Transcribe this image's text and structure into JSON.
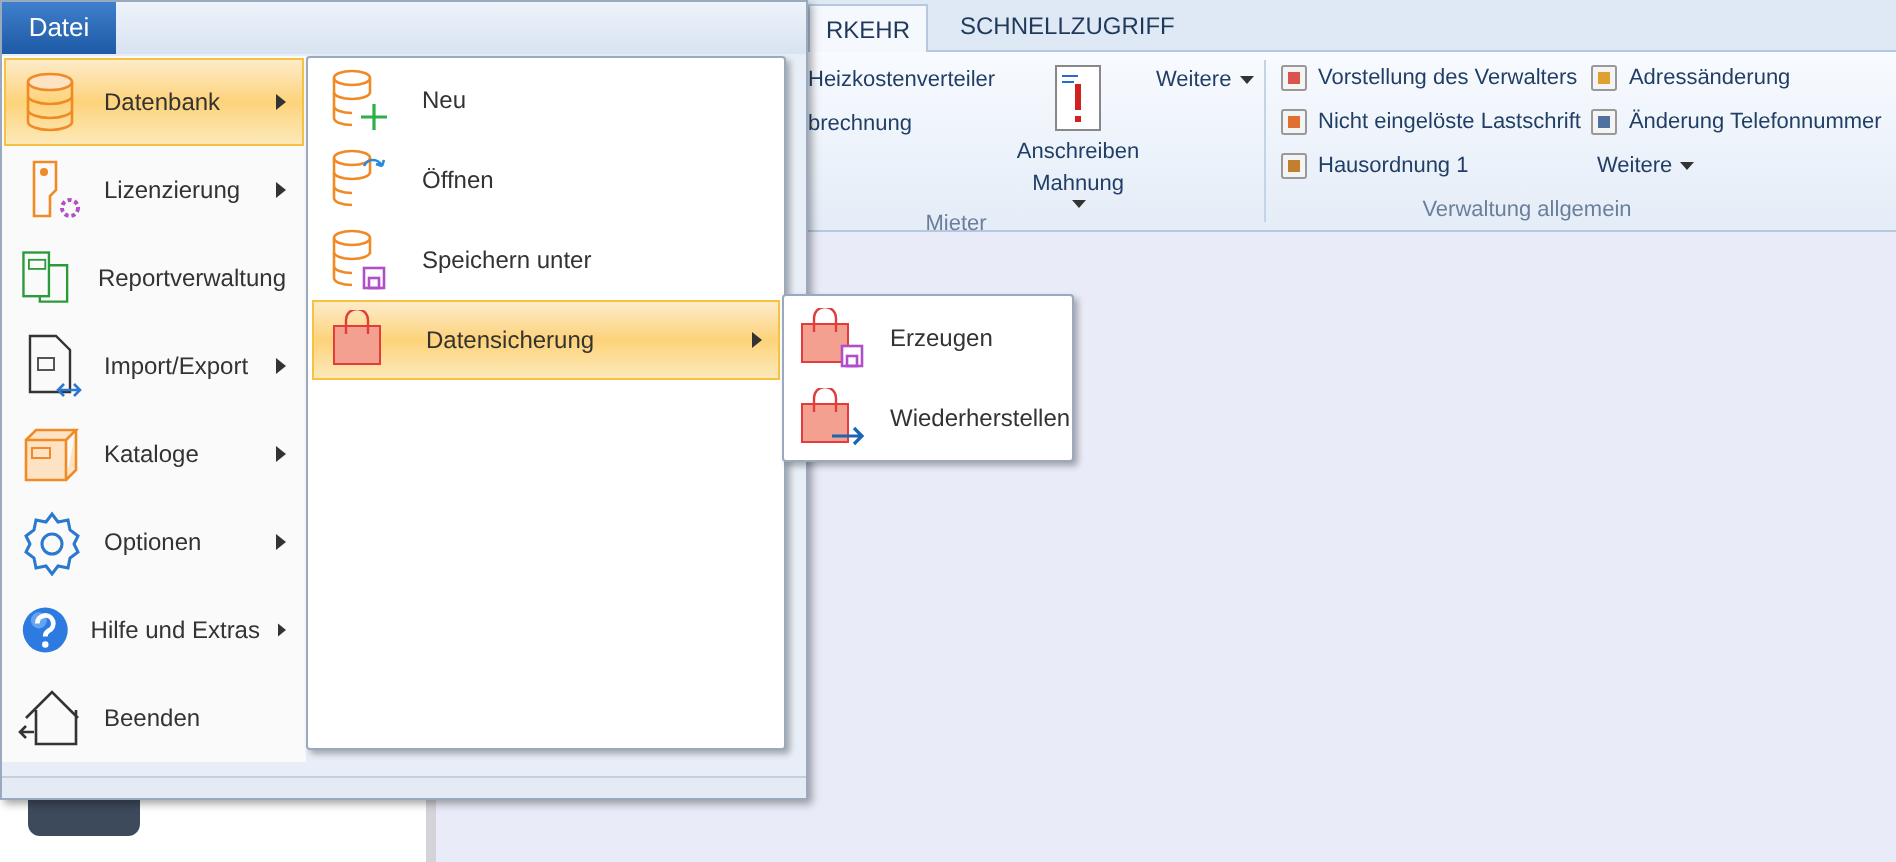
{
  "ribbon": {
    "tabs": [
      {
        "label": "RKEHR",
        "selected": true
      },
      {
        "label": "SCHNELLZUGRIFF",
        "selected": false
      }
    ],
    "groups": [
      {
        "label": "Mieter",
        "small_items": [
          "Heizkostenverteiler",
          "brechnung"
        ],
        "large_button": {
          "label": "Anschreiben Mahnung"
        },
        "dropdown": "Weitere"
      },
      {
        "label": "Verwaltung allgemein",
        "columns": [
          [
            "Vorstellung des Verwalters",
            "Nicht eingelöste Lastschrift",
            "Hausordnung 1"
          ],
          [
            "Adressänderung",
            "Änderung Telefonnummer"
          ]
        ],
        "dropdown": "Weitere"
      }
    ]
  },
  "file_menu": {
    "button": "Datei",
    "items": [
      {
        "label": "Datenbank",
        "has_submenu": true,
        "selected": true
      },
      {
        "label": "Lizenzierung",
        "has_submenu": true,
        "selected": false
      },
      {
        "label": "Reportverwaltung",
        "has_submenu": false,
        "selected": false
      },
      {
        "label": "Import/Export",
        "has_submenu": true,
        "selected": false
      },
      {
        "label": "Kataloge",
        "has_submenu": true,
        "selected": false
      },
      {
        "label": "Optionen",
        "has_submenu": true,
        "selected": false
      },
      {
        "label": "Hilfe und Extras",
        "has_submenu": true,
        "selected": false
      },
      {
        "label": "Beenden",
        "has_submenu": false,
        "selected": false
      }
    ],
    "submenu": [
      {
        "label": "Neu",
        "has_submenu": false,
        "selected": false
      },
      {
        "label": "Öffnen",
        "has_submenu": false,
        "selected": false
      },
      {
        "label": "Speichern unter",
        "has_submenu": false,
        "selected": false
      },
      {
        "label": "Datensicherung",
        "has_submenu": true,
        "selected": true
      }
    ],
    "flyout": [
      {
        "label": "Erzeugen"
      },
      {
        "label": "Wiederherstellen"
      }
    ]
  }
}
